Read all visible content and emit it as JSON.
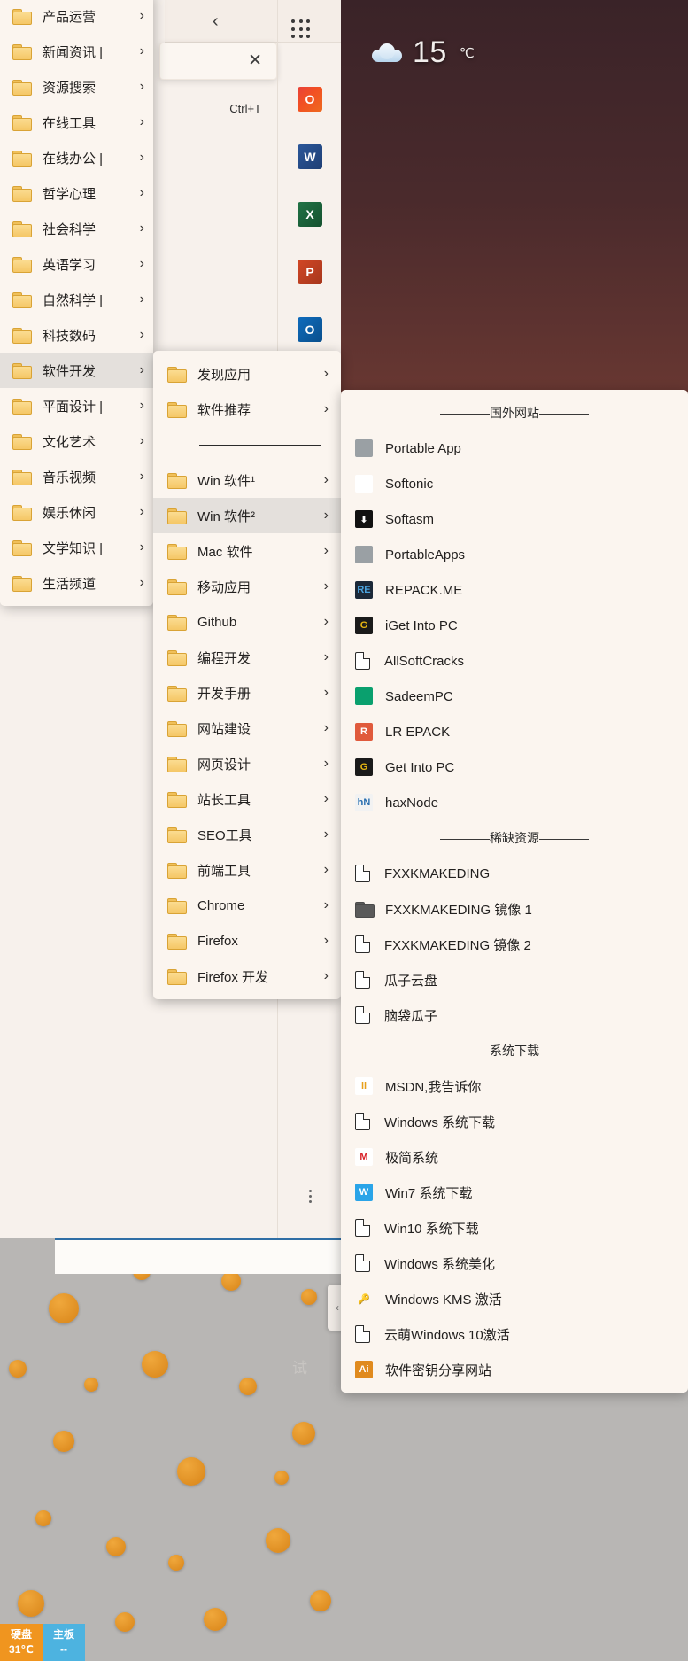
{
  "desktop": {
    "weather": {
      "icon": "cloud-icon",
      "temperature": "15",
      "unit": "℃"
    },
    "watermark": "试"
  },
  "browser": {
    "back_label": "‹",
    "apps_grid_name": "apps-grid-icon",
    "close_label": "✕",
    "shortcut_hint": "Ctrl+T",
    "rail_icons": [
      {
        "name": "office-icon",
        "label": "O"
      },
      {
        "name": "word-icon",
        "label": "W"
      },
      {
        "name": "excel-icon",
        "label": "X"
      },
      {
        "name": "powerpoint-icon",
        "label": "P"
      },
      {
        "name": "outlook-icon",
        "label": "O"
      }
    ],
    "edge_tab_label": "‹",
    "more_label": "⋮"
  },
  "menu_level1": {
    "items": [
      {
        "label": "产品运营",
        "chevron": "›"
      },
      {
        "label": "新闻资讯 |",
        "chevron": "›"
      },
      {
        "label": "资源搜索",
        "chevron": "›"
      },
      {
        "label": "在线工具",
        "chevron": "›"
      },
      {
        "label": "在线办公 |",
        "chevron": "›"
      },
      {
        "label": "哲学心理",
        "chevron": "›"
      },
      {
        "label": "社会科学",
        "chevron": "›"
      },
      {
        "label": "英语学习",
        "chevron": "›"
      },
      {
        "label": "自然科学 |",
        "chevron": "›"
      },
      {
        "label": "科技数码",
        "chevron": "›"
      },
      {
        "label": "软件开发",
        "chevron": "›",
        "highlighted": true
      },
      {
        "label": "平面设计 |",
        "chevron": "›"
      },
      {
        "label": "文化艺术",
        "chevron": "›"
      },
      {
        "label": "音乐视频",
        "chevron": "›"
      },
      {
        "label": "娱乐休闲",
        "chevron": "›"
      },
      {
        "label": "文学知识 |",
        "chevron": "›"
      },
      {
        "label": "生活频道",
        "chevron": "›"
      }
    ]
  },
  "menu_level2": {
    "items": [
      {
        "type": "folder",
        "label": "发现应用",
        "chevron": "›"
      },
      {
        "type": "folder",
        "label": "软件推荐",
        "chevron": "›"
      },
      {
        "type": "divider"
      },
      {
        "type": "folder",
        "label": "Win 软件¹",
        "chevron": "›"
      },
      {
        "type": "folder",
        "label": "Win 软件²",
        "chevron": "›",
        "highlighted": true
      },
      {
        "type": "folder",
        "label": "Mac 软件",
        "chevron": "›"
      },
      {
        "type": "folder",
        "label": "移动应用",
        "chevron": "›"
      },
      {
        "type": "folder",
        "label": "Github",
        "chevron": "›"
      },
      {
        "type": "folder",
        "label": "编程开发",
        "chevron": "›"
      },
      {
        "type": "folder",
        "label": "开发手册",
        "chevron": "›"
      },
      {
        "type": "folder",
        "label": "网站建设",
        "chevron": "›"
      },
      {
        "type": "folder",
        "label": "网页设计",
        "chevron": "›"
      },
      {
        "type": "folder",
        "label": "站长工具",
        "chevron": "›"
      },
      {
        "type": "folder",
        "label": "SEO工具",
        "chevron": "›"
      },
      {
        "type": "folder",
        "label": "前端工具",
        "chevron": "›"
      },
      {
        "type": "folder",
        "label": "Chrome",
        "chevron": "›"
      },
      {
        "type": "folder",
        "label": "Firefox",
        "chevron": "›"
      },
      {
        "type": "folder",
        "label": "Firefox 开发",
        "chevron": "›"
      }
    ]
  },
  "menu_level3": {
    "items": [
      {
        "type": "section",
        "label": "————国外网站————"
      },
      {
        "type": "link",
        "label": "Portable App",
        "icon": "portableapp-icon",
        "icon_text": "",
        "icon_bg": "#9aa0a4",
        "icon_fg": "#ffffff"
      },
      {
        "type": "link",
        "label": "Softonic",
        "icon": "softonic-icon",
        "icon_text": "",
        "icon_bg": "#ffffff",
        "icon_fg": "#7fb9e0"
      },
      {
        "type": "link",
        "label": "Softasm",
        "icon": "softasm-icon",
        "icon_text": "⬇",
        "icon_bg": "#111111",
        "icon_fg": "#ffffff"
      },
      {
        "type": "link",
        "label": "PortableApps",
        "icon": "portableapps-icon",
        "icon_text": "",
        "icon_bg": "#9aa0a4",
        "icon_fg": "#ffffff"
      },
      {
        "type": "link",
        "label": "REPACK.ME",
        "icon": "repackme-icon",
        "icon_text": "RE",
        "icon_bg": "#1b2838",
        "icon_fg": "#4aa3df"
      },
      {
        "type": "link",
        "label": "iGet Into PC",
        "icon": "igetintopc-icon",
        "icon_text": "G",
        "icon_bg": "#1a1a1a",
        "icon_fg": "#e8b712"
      },
      {
        "type": "link",
        "label": "AllSoftCracks",
        "icon": "page-icon"
      },
      {
        "type": "link",
        "label": "SadeemPC",
        "icon": "sadeempc-icon",
        "icon_text": "",
        "icon_bg": "#0aa06e",
        "icon_fg": "#ffffff"
      },
      {
        "type": "link",
        "label": "LR EPACK",
        "icon": "lrepack-icon",
        "icon_text": "R",
        "icon_bg": "#e05a3c",
        "icon_fg": "#ffffff"
      },
      {
        "type": "link",
        "label": "Get Into PC",
        "icon": "getintopc-icon",
        "icon_text": "G",
        "icon_bg": "#1a1a1a",
        "icon_fg": "#e8b712"
      },
      {
        "type": "link",
        "label": "haxNode",
        "icon": "haxnode-icon",
        "icon_text": "hN",
        "icon_bg": "#f2f2f2",
        "icon_fg": "#2a6fb0"
      },
      {
        "type": "section",
        "label": "————稀缺资源————"
      },
      {
        "type": "link",
        "label": "FXXKMAKEDING",
        "icon": "page-icon"
      },
      {
        "type": "folder-dark",
        "label": "FXXKMAKEDING 镜像 1"
      },
      {
        "type": "link",
        "label": "FXXKMAKEDING 镜像 2",
        "icon": "page-icon"
      },
      {
        "type": "link",
        "label": "瓜子云盘",
        "icon": "page-icon"
      },
      {
        "type": "link",
        "label": "脑袋瓜子",
        "icon": "page-icon"
      },
      {
        "type": "section",
        "label": "————系统下载————"
      },
      {
        "type": "link",
        "label": "MSDN,我告诉你",
        "icon": "msdn-icon",
        "icon_text": "ii",
        "icon_bg": "#ffffff",
        "icon_fg": "#e8a01a"
      },
      {
        "type": "link",
        "label": "Windows 系统下载",
        "icon": "page-icon"
      },
      {
        "type": "link",
        "label": "极简系统",
        "icon": "minimal-system-icon",
        "icon_text": "M",
        "icon_bg": "#ffffff",
        "icon_fg": "#d81f26"
      },
      {
        "type": "link",
        "label": "Win7 系统下载",
        "icon": "win7-icon",
        "icon_text": "W",
        "icon_bg": "#2aa4e8",
        "icon_fg": "#ffffff"
      },
      {
        "type": "link",
        "label": "Win10 系统下载",
        "icon": "page-icon"
      },
      {
        "type": "link",
        "label": "Windows 系统美化",
        "icon": "page-icon"
      },
      {
        "type": "link",
        "label": "Windows KMS 激活",
        "icon": "key-icon",
        "icon_text": "🔑",
        "icon_bg": "transparent",
        "icon_fg": "#c9a227"
      },
      {
        "type": "link",
        "label": "云萌Windows 10激活",
        "icon": "page-icon"
      },
      {
        "type": "link",
        "label": "软件密钥分享网站",
        "icon": "ai-icon",
        "icon_text": "Ai",
        "icon_bg": "#e08a1e",
        "icon_fg": "#ffffff"
      }
    ]
  },
  "taskbar": {
    "widgets": [
      {
        "name": "hdd-temp",
        "title": "硬盘",
        "value": "31℃"
      },
      {
        "name": "motherboard-temp",
        "title": "主板",
        "value": "--"
      }
    ]
  }
}
